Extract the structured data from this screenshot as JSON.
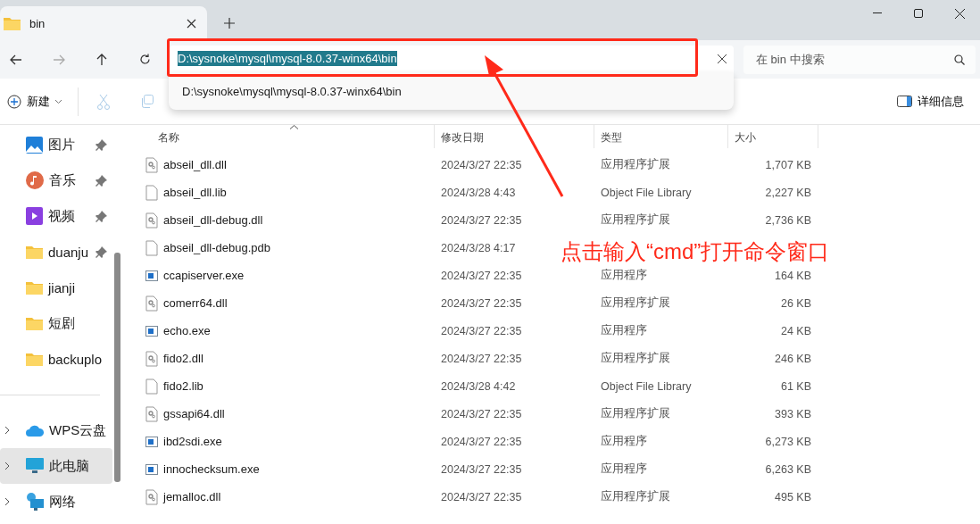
{
  "tab": {
    "title": "bin",
    "selected": true
  },
  "address": {
    "value": "D:\\sysnoke\\mysql\\mysql-8.0.37-winx64\\bin",
    "text_selected": true,
    "suggestions": [
      "D:\\sysnoke\\mysql\\mysql-8.0.37-winx64\\bin"
    ]
  },
  "nav": {
    "back_disabled": false,
    "forward_disabled": true
  },
  "search": {
    "placeholder": "在 bin 中搜索"
  },
  "commands": {
    "new_label": "新建",
    "cut_disabled": true,
    "copy_disabled": true,
    "details_label": "详细信息"
  },
  "sidebar": {
    "items": [
      {
        "label": "图片",
        "kind": "pictures",
        "pinned": true,
        "selected": false
      },
      {
        "label": "音乐",
        "kind": "music",
        "pinned": true,
        "selected": false
      },
      {
        "label": "视频",
        "kind": "videos",
        "pinned": true,
        "selected": false
      },
      {
        "label": "duanju",
        "kind": "folder",
        "pinned": true,
        "selected": false
      },
      {
        "label": "jianji",
        "kind": "folder",
        "pinned": false,
        "selected": false
      },
      {
        "label": "短剧",
        "kind": "folder",
        "pinned": false,
        "selected": false
      },
      {
        "label": "backuplo",
        "kind": "folder",
        "pinned": false,
        "selected": false
      }
    ],
    "locations": [
      {
        "label": "WPS云盘",
        "kind": "cloud",
        "selected": false
      },
      {
        "label": "此电脑",
        "kind": "pc",
        "selected": true
      },
      {
        "label": "网络",
        "kind": "network",
        "selected": false
      }
    ]
  },
  "table": {
    "columns": [
      "名称",
      "修改日期",
      "类型",
      "大小"
    ],
    "rows": [
      {
        "name": "abseil_dll.dll",
        "kind": "dll",
        "date": "2024/3/27 22:35",
        "type": "应用程序扩展",
        "size": "1,707 KB"
      },
      {
        "name": "abseil_dll.lib",
        "kind": "doc",
        "date": "2024/3/28 4:43",
        "type": "Object File Library",
        "size": "2,227 KB"
      },
      {
        "name": "abseil_dll-debug.dll",
        "kind": "dll",
        "date": "2024/3/27 22:35",
        "type": "应用程序扩展",
        "size": "2,736 KB"
      },
      {
        "name": "abseil_dll-debug.pdb",
        "kind": "doc",
        "date": "2024/3/28 4:17"
      },
      {
        "name": "ccapiserver.exe",
        "kind": "exe",
        "date": "2024/3/27 22:35",
        "type": "应用程序",
        "size": "164 KB"
      },
      {
        "name": "comerr64.dll",
        "kind": "dll",
        "date": "2024/3/27 22:35",
        "type": "应用程序扩展",
        "size": "26 KB"
      },
      {
        "name": "echo.exe",
        "kind": "exe",
        "date": "2024/3/27 22:35",
        "type": "应用程序",
        "size": "24 KB"
      },
      {
        "name": "fido2.dll",
        "kind": "dll",
        "date": "2024/3/27 22:35",
        "type": "应用程序扩展",
        "size": "246 KB"
      },
      {
        "name": "fido2.lib",
        "kind": "doc",
        "date": "2024/3/28 4:42",
        "type": "Object File Library",
        "size": "61 KB"
      },
      {
        "name": "gssapi64.dll",
        "kind": "dll",
        "date": "2024/3/27 22:35",
        "type": "应用程序扩展",
        "size": "393 KB"
      },
      {
        "name": "ibd2sdi.exe",
        "kind": "exe",
        "date": "2024/3/27 22:35",
        "type": "应用程序",
        "size": "6,273 KB"
      },
      {
        "name": "innochecksum.exe",
        "kind": "exe",
        "date": "2024/3/27 22:35",
        "type": "应用程序",
        "size": "6,263 KB"
      },
      {
        "name": "jemalloc.dll",
        "kind": "dll",
        "date": "2024/3/27 22:35",
        "type": "应用程序扩展",
        "size": "495 KB"
      }
    ]
  },
  "annotation": {
    "text": "点击输入“cmd”打开命令窗口",
    "color": "#ff2a1a"
  }
}
